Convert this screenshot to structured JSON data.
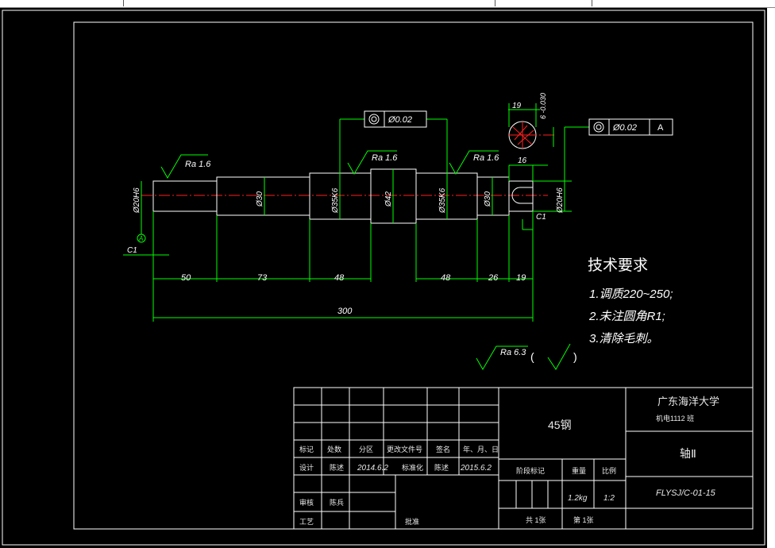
{
  "dimensions": {
    "d50": "50",
    "d73": "73",
    "d48a": "48",
    "d48b": "48",
    "d26": "26",
    "d19": "19",
    "d300": "300",
    "d16": "16",
    "d19top": "19",
    "tol": "6 -0.030",
    "dia_left": "Ø20H6",
    "dia_30a": "Ø30",
    "dia_35a": "Ø35K6",
    "dia_42": "Ø42",
    "dia_35b": "Ø35K6",
    "dia_30b": "Ø30",
    "dia_right": "Ø20H6",
    "c1_left": "C1",
    "c1_right": "C1",
    "datum": "A"
  },
  "roughness": {
    "ra_left": "Ra 1.6",
    "ra_mid": "Ra 1.6",
    "ra_right": "Ra 1.6",
    "ra_general": "Ra 6.3"
  },
  "tolerance_frames": {
    "frame1_value": "Ø0.02",
    "frame2_value": "Ø0.02",
    "frame2_datum": "A"
  },
  "tech_req": {
    "title": "技术要求",
    "line1": "1.调质220~250;",
    "line2": "2.未注圆角R1;",
    "line3": "3.清除毛刺。"
  },
  "title_block": {
    "material": "45钢",
    "university": "广东海洋大学",
    "class": "机电1112 班",
    "part_name": "轴Ⅱ",
    "drawing_no": "FLYSJ/C-01-15",
    "mark": "标记",
    "count": "处数",
    "zone": "分区",
    "change_doc": "更改文件号",
    "signature": "签名",
    "date_label": "年、月、日",
    "design": "设计",
    "designer": "陈述",
    "design_date": "2014.6.2",
    "standard": "标准化",
    "std_person": "陈述",
    "std_date": "2015.6.2",
    "stage_mark": "阶段标记",
    "weight": "重量",
    "scale": "比例",
    "weight_value": "1.2kg",
    "scale_value": "1:2",
    "review": "审核",
    "reviewer": "陈兵",
    "process": "工艺",
    "approve": "批准",
    "sheets_total": "共 1张",
    "sheet_no": "第 1张"
  }
}
